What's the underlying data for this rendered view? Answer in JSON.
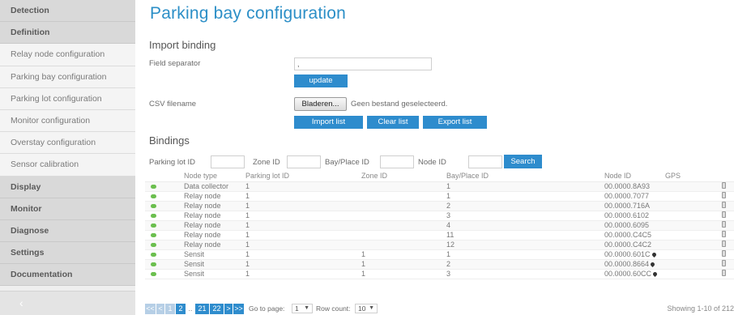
{
  "sidebar": {
    "items": [
      {
        "label": "Detection"
      },
      {
        "label": "Definition"
      },
      {
        "label": "Relay node configuration"
      },
      {
        "label": "Parking bay configuration"
      },
      {
        "label": "Parking lot configuration"
      },
      {
        "label": "Monitor configuration"
      },
      {
        "label": "Overstay configuration"
      },
      {
        "label": "Sensor calibration"
      },
      {
        "label": "Display"
      },
      {
        "label": "Monitor"
      },
      {
        "label": "Diagnose"
      },
      {
        "label": "Settings"
      },
      {
        "label": "Documentation"
      }
    ],
    "collapse_icon": "chevron-left-icon"
  },
  "page": {
    "title": "Parking bay configuration"
  },
  "import_binding": {
    "title": "Import binding",
    "field_separator_label": "Field separator",
    "field_separator_value": ",",
    "update_label": "update",
    "csv_label": "CSV filename",
    "browse_label": "Bladeren...",
    "no_file_text": "Geen bestand geselecteerd.",
    "import_label": "Import list",
    "clear_label": "Clear list",
    "export_label": "Export list"
  },
  "bindings": {
    "title": "Bindings",
    "filters": {
      "parking_lot_label": "Parking lot ID",
      "parking_lot_value": "",
      "zone_label": "Zone ID",
      "zone_value": "",
      "bay_label": "Bay/Place ID",
      "bay_value": "",
      "node_label": "Node ID",
      "node_value": "",
      "search_label": "Search"
    },
    "columns": [
      "",
      "Node type",
      "Parking lot ID",
      "Zone ID",
      "Bay/Place ID",
      "Node ID",
      "GPS",
      ""
    ],
    "rows": [
      {
        "type": "Data collector",
        "lot": "1",
        "zone": "",
        "bay": "1",
        "node": "00.0000.8A93",
        "gps": false
      },
      {
        "type": "Relay node",
        "lot": "1",
        "zone": "",
        "bay": "1",
        "node": "00.0000.7077",
        "gps": false
      },
      {
        "type": "Relay node",
        "lot": "1",
        "zone": "",
        "bay": "2",
        "node": "00.0000.716A",
        "gps": false
      },
      {
        "type": "Relay node",
        "lot": "1",
        "zone": "",
        "bay": "3",
        "node": "00.0000.6102",
        "gps": false
      },
      {
        "type": "Relay node",
        "lot": "1",
        "zone": "",
        "bay": "4",
        "node": "00.0000.6095",
        "gps": false
      },
      {
        "type": "Relay node",
        "lot": "1",
        "zone": "",
        "bay": "11",
        "node": "00.0000.C4C5",
        "gps": false
      },
      {
        "type": "Relay node",
        "lot": "1",
        "zone": "",
        "bay": "12",
        "node": "00.0000.C4C2",
        "gps": false
      },
      {
        "type": "Sensit",
        "lot": "1",
        "zone": "1",
        "bay": "1",
        "node": "00.0000.601C",
        "gps": true
      },
      {
        "type": "Sensit",
        "lot": "1",
        "zone": "1",
        "bay": "2",
        "node": "00.0000.8664",
        "gps": true
      },
      {
        "type": "Sensit",
        "lot": "1",
        "zone": "1",
        "bay": "3",
        "node": "00.0000.60CC",
        "gps": true
      }
    ],
    "status_color": "#6bbf4e"
  },
  "pager": {
    "first": "<<",
    "prev": "<",
    "pages": [
      "1",
      "2"
    ],
    "ellipsis": "..",
    "tail_pages": [
      "21",
      "22"
    ],
    "next": ">",
    "last": ">>",
    "goto_label": "Go to page:",
    "goto_value": "1",
    "rowcount_label": "Row count:",
    "rowcount_value": "10",
    "showing_text": "Showing 1-10 of 212"
  },
  "colors": {
    "accent": "#2e8ccd",
    "title": "#2c8fc7"
  }
}
